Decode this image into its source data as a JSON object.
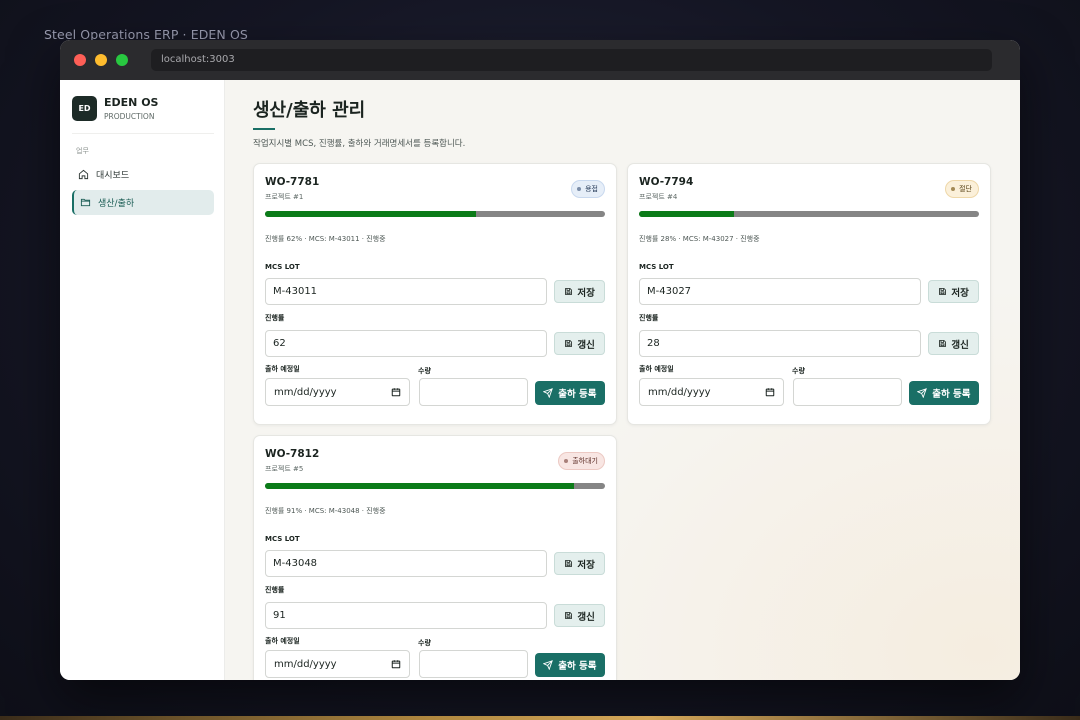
{
  "outer_title": "Steel Operations ERP · EDEN OS",
  "browser": {
    "url": "localhost:3003"
  },
  "sidebar": {
    "logo": "ED",
    "brand_name": "EDEN OS",
    "brand_sub": "PRODUCTION",
    "section": "업무",
    "items": [
      {
        "label": "대시보드",
        "icon": "home-icon",
        "active": false
      },
      {
        "label": "생산/출하",
        "icon": "folder-icon",
        "active": true
      }
    ]
  },
  "page": {
    "title": "생산/출하 관리",
    "description": "작업지시별 MCS, 진행률, 출하와 거래명세서를 등록합니다."
  },
  "form_labels": {
    "mcs_lot": "MCS LOT",
    "progress": "진행률",
    "ship_date": "출하 예정일",
    "quantity": "수량",
    "save": "저장",
    "update": "갱신",
    "register": "출하 등록",
    "date_placeholder": "mm/dd/yyyy"
  },
  "work_orders": [
    {
      "id": "WO-7781",
      "project": "프로젝트 #1",
      "status": "용접",
      "status_color": "blue",
      "progress": 62,
      "meta": "진행률 62% · MCS: M-43011 · 진행중",
      "mcs_lot": "M-43011",
      "progress_value": "62"
    },
    {
      "id": "WO-7794",
      "project": "프로젝트 #4",
      "status": "절단",
      "status_color": "amber",
      "progress": 28,
      "meta": "진행률 28% · MCS: M-43027 · 진행중",
      "mcs_lot": "M-43027",
      "progress_value": "28"
    },
    {
      "id": "WO-7812",
      "project": "프로젝트 #5",
      "status": "출하대기",
      "status_color": "red",
      "progress": 91,
      "meta": "진행률 91% · MCS: M-43048 · 진행중",
      "mcs_lot": "M-43048",
      "progress_value": "91"
    }
  ],
  "colors": {
    "accent": "#1a6f66",
    "progress_fill": "#0b7b18",
    "progress_track": "#858585"
  }
}
